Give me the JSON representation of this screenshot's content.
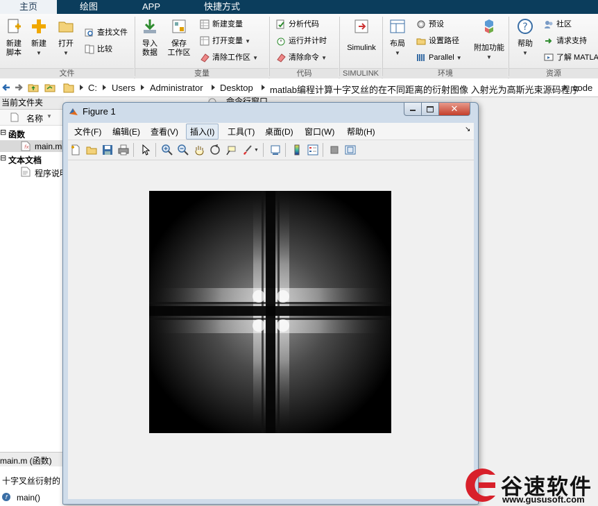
{
  "tabs": [
    "主页",
    "绘图",
    "APP",
    "快捷方式"
  ],
  "ribbon": {
    "file": {
      "label": "文件",
      "new_script": [
        "新建",
        "脚本"
      ],
      "new": "新建",
      "open": "打开",
      "find_files": "查找文件",
      "compare": "比较"
    },
    "variable": {
      "label": "变量",
      "import": [
        "导入",
        "数据"
      ],
      "save_ws": [
        "保存",
        "工作区"
      ],
      "new_var": "新建变量",
      "open_var": "打开变量",
      "clear_ws": "清除工作区"
    },
    "code": {
      "label": "代码",
      "analyze": "分析代码",
      "run_time": "运行并计时",
      "clear_cmd": "清除命令"
    },
    "simulink": {
      "label": "SIMULINK",
      "btn": "Simulink"
    },
    "env": {
      "label": "环境",
      "layout": "布局",
      "prefs": "预设",
      "set_path": "设置路径",
      "parallel": "Parallel",
      "addons": "附加功能"
    },
    "resources": {
      "label": "资源",
      "help": "帮助",
      "community": "社区",
      "support": "请求支持",
      "learn": "了解 MATLA"
    }
  },
  "address": {
    "crumbs": [
      "C:",
      "Users",
      "Administrator",
      "Desktop",
      "matlab编程计算十字叉丝的在不同距离的衍射图像 入射光为高斯光束源码程序",
      "code"
    ]
  },
  "left_panel": {
    "title": "当前文件夹",
    "col_name": "名称",
    "group_functions": "函数",
    "file_main": "main.m",
    "group_text": "文本文档",
    "file_readme": "程序说明",
    "details_header": "main.m  (函数)",
    "details_desc": "十字叉丝衍射的",
    "details_func": "main()"
  },
  "cmd_window_title": "命令行窗口",
  "figure": {
    "title": "Figure 1",
    "menus": [
      "文件(F)",
      "编辑(E)",
      "查看(V)",
      "插入(I)",
      "工具(T)",
      "桌面(D)",
      "窗口(W)",
      "帮助(H)"
    ],
    "active_menu_index": 3
  },
  "watermark": {
    "brand": "谷速软件",
    "url": "www.gususoft.com"
  },
  "colors": {
    "tabbar": "#0b3d5c",
    "ribbon_bg": "#f0f0f0",
    "figure_frame": "#cfdcea",
    "watermark_red": "#d8202a"
  }
}
